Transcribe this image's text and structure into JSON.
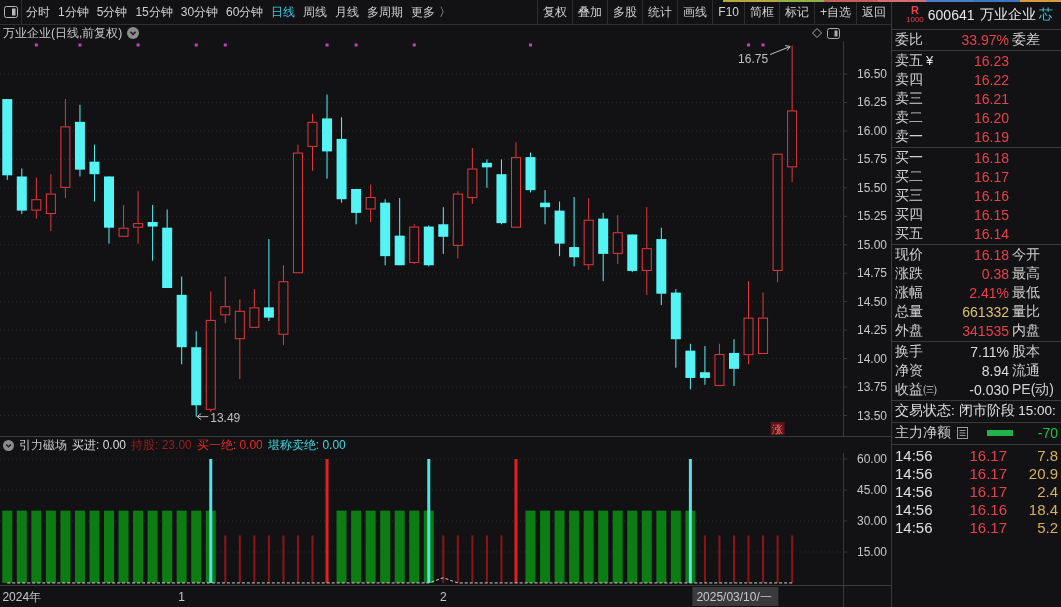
{
  "toolbar": {
    "periods": [
      {
        "label": "分时",
        "selected": false
      },
      {
        "label": "1分钟",
        "selected": false
      },
      {
        "label": "5分钟",
        "selected": false
      },
      {
        "label": "15分钟",
        "selected": false
      },
      {
        "label": "30分钟",
        "selected": false
      },
      {
        "label": "60分钟",
        "selected": false
      },
      {
        "label": "日线",
        "selected": true
      },
      {
        "label": "周线",
        "selected": false
      },
      {
        "label": "月线",
        "selected": false
      },
      {
        "label": "多周期",
        "selected": false
      },
      {
        "label": "更多 〉",
        "selected": false
      }
    ],
    "buttons": [
      "复权",
      "叠加",
      "多股",
      "统计",
      "画线",
      "F10",
      "简框",
      "标记",
      "+自选",
      "返回"
    ]
  },
  "chart": {
    "title": "万业企业(日线,前复权)",
    "signal_tag": "涨",
    "chart_data": [
      {
        "type": "candlestick",
        "ohlc": [
          [
            16.28,
            16.28,
            15.57,
            15.61
          ],
          [
            15.6,
            15.67,
            15.27,
            15.3
          ],
          [
            15.3,
            15.59,
            15.23,
            15.4
          ],
          [
            15.27,
            15.62,
            15.12,
            15.45
          ],
          [
            15.5,
            16.28,
            15.41,
            16.04
          ],
          [
            16.08,
            16.23,
            15.6,
            15.66
          ],
          [
            15.73,
            15.88,
            15.38,
            15.62
          ],
          [
            15.6,
            15.6,
            15.01,
            15.15
          ],
          [
            15.07,
            15.35,
            15.07,
            15.15
          ],
          [
            15.15,
            15.47,
            15.01,
            15.19
          ],
          [
            15.2,
            15.35,
            14.86,
            15.16
          ],
          [
            15.15,
            15.31,
            14.62,
            14.62
          ],
          [
            14.56,
            14.72,
            13.95,
            14.1
          ],
          [
            14.1,
            14.24,
            13.49,
            13.59
          ],
          [
            13.55,
            14.59,
            13.53,
            14.34
          ],
          [
            14.38,
            14.72,
            14.31,
            14.46
          ],
          [
            14.17,
            14.52,
            13.82,
            14.42
          ],
          [
            14.27,
            14.61,
            14.27,
            14.45
          ],
          [
            14.45,
            15.05,
            14.33,
            14.36
          ],
          [
            14.21,
            14.82,
            14.12,
            14.68
          ],
          [
            14.75,
            15.88,
            14.75,
            15.81
          ],
          [
            15.86,
            16.15,
            15.65,
            16.08
          ],
          [
            16.11,
            16.32,
            15.58,
            15.82
          ],
          [
            15.93,
            16.12,
            15.37,
            15.4
          ],
          [
            15.49,
            15.49,
            15.18,
            15.28
          ],
          [
            15.31,
            15.53,
            15.2,
            15.42
          ],
          [
            15.37,
            15.4,
            14.82,
            14.9
          ],
          [
            15.08,
            15.41,
            14.82,
            14.82
          ],
          [
            14.84,
            15.18,
            14.83,
            15.16
          ],
          [
            15.16,
            15.17,
            14.81,
            14.82
          ],
          [
            15.18,
            15.33,
            14.92,
            15.07
          ],
          [
            14.99,
            15.47,
            14.88,
            15.45
          ],
          [
            15.41,
            15.85,
            15.36,
            15.67
          ],
          [
            15.72,
            15.75,
            15.5,
            15.68
          ],
          [
            15.62,
            15.75,
            15.18,
            15.19
          ],
          [
            15.15,
            15.9,
            15.15,
            15.77
          ],
          [
            15.77,
            15.81,
            15.46,
            15.48
          ],
          [
            15.37,
            15.48,
            15.18,
            15.33
          ],
          [
            15.3,
            15.38,
            14.9,
            15.01
          ],
          [
            14.98,
            15.42,
            14.81,
            14.89
          ],
          [
            14.82,
            15.41,
            14.78,
            15.22
          ],
          [
            15.23,
            15.28,
            14.68,
            14.92
          ],
          [
            14.92,
            15.26,
            14.83,
            15.11
          ],
          [
            15.09,
            15.09,
            14.76,
            14.77
          ],
          [
            14.77,
            15.33,
            14.56,
            14.97
          ],
          [
            15.05,
            15.15,
            14.47,
            14.57
          ],
          [
            14.58,
            14.61,
            13.92,
            14.17
          ],
          [
            14.07,
            14.13,
            13.73,
            13.83
          ],
          [
            13.88,
            14.11,
            13.77,
            13.83
          ],
          [
            13.76,
            14.13,
            13.76,
            14.04
          ],
          [
            14.05,
            14.17,
            13.76,
            13.91
          ],
          [
            14.03,
            14.68,
            13.95,
            14.36
          ],
          [
            14.04,
            14.58,
            14.04,
            14.36
          ],
          [
            14.77,
            15.8,
            14.67,
            15.8
          ],
          [
            15.68,
            16.75,
            15.55,
            16.18
          ],
          null,
          null,
          null
        ],
        "ylim": [
          13.32,
          16.79
        ],
        "yticks": [
          {
            "value": 13.5,
            "label": "13.50"
          },
          {
            "value": 13.75,
            "label": "13.75"
          },
          {
            "value": 14,
            "label": "14.00"
          },
          {
            "value": 14.25,
            "label": "14.25"
          },
          {
            "value": 14.5,
            "label": "14.50"
          },
          {
            "value": 14.75,
            "label": "14.75"
          },
          {
            "value": 15,
            "label": "15.00"
          },
          {
            "value": 15.25,
            "label": "15.25"
          },
          {
            "value": 15.5,
            "label": "15.50"
          },
          {
            "value": 15.75,
            "label": "15.75"
          },
          {
            "value": 16,
            "label": "16.00"
          },
          {
            "value": 16.25,
            "label": "16.25"
          },
          {
            "value": 16.5,
            "label": "16.50"
          }
        ],
        "grid": true,
        "annotations": [
          "16.75",
          "13.49"
        ]
      }
    ]
  },
  "indicator": {
    "name": "引力磁场",
    "readouts": [
      {
        "text": "买进: 0.00",
        "color": "#dcdcdc"
      },
      {
        "text": "持股: 23.00",
        "color": "#9a1e1e"
      },
      {
        "text": "买一绝: 0.00",
        "color": "#e82828"
      },
      {
        "text": "堪称卖绝: 0.00",
        "color": "#40d8e0"
      }
    ],
    "cursor_date": "2025/03/10/一",
    "chart_data": [
      {
        "type": "bar",
        "categories": [
          null,
          "2024年",
          null,
          null,
          null,
          null,
          null,
          null,
          null,
          null,
          null,
          null,
          "1",
          null,
          null,
          null,
          null,
          null,
          null,
          null,
          null,
          null,
          null,
          null,
          null,
          null,
          null,
          null,
          null,
          null,
          "2",
          null,
          null,
          null,
          null,
          null,
          null,
          null,
          null,
          null,
          null,
          null,
          null,
          null,
          null,
          null,
          null,
          null,
          null,
          null,
          null,
          null,
          null,
          null,
          null,
          null,
          null,
          null
        ],
        "series": [
          {
            "type": "bar",
            "color": "#0b7d12",
            "values": [
              35,
              35,
              35,
              35,
              35,
              35,
              35,
              35,
              35,
              35,
              35,
              35,
              35,
              35,
              35,
              null,
              null,
              null,
              null,
              null,
              null,
              null,
              null,
              35,
              35,
              35,
              35,
              35,
              35,
              35,
              null,
              null,
              null,
              null,
              null,
              null,
              35,
              35,
              35,
              35,
              35,
              35,
              35,
              35,
              35,
              35,
              35,
              35,
              null,
              null,
              null,
              null,
              null,
              null,
              null,
              null,
              null,
              null
            ]
          },
          {
            "type": "bar",
            "color": "#8e1414",
            "values": [
              null,
              null,
              null,
              null,
              null,
              null,
              null,
              null,
              null,
              null,
              null,
              null,
              null,
              null,
              null,
              23,
              23,
              23,
              23,
              23,
              23,
              23,
              null,
              null,
              null,
              null,
              null,
              null,
              null,
              null,
              23,
              23,
              23,
              23,
              23,
              null,
              null,
              null,
              null,
              null,
              null,
              null,
              null,
              null,
              null,
              null,
              null,
              null,
              23,
              23,
              23,
              23,
              23,
              23,
              23,
              null,
              null,
              null
            ]
          },
          {
            "type": "bar",
            "color": "#e3201e",
            "values": [
              null,
              null,
              null,
              null,
              null,
              null,
              null,
              null,
              null,
              null,
              null,
              null,
              null,
              null,
              null,
              null,
              null,
              null,
              null,
              null,
              null,
              null,
              60,
              null,
              null,
              null,
              null,
              null,
              null,
              null,
              null,
              null,
              null,
              null,
              null,
              60,
              null,
              null,
              null,
              null,
              null,
              null,
              null,
              null,
              null,
              null,
              null,
              null,
              null,
              null,
              null,
              null,
              null,
              null,
              null,
              null,
              null,
              null
            ]
          },
          {
            "type": "bar",
            "color": "#4fe3ea",
            "values": [
              null,
              null,
              null,
              null,
              null,
              null,
              null,
              null,
              null,
              null,
              null,
              null,
              null,
              null,
              60,
              null,
              null,
              null,
              null,
              null,
              null,
              null,
              null,
              null,
              null,
              null,
              null,
              null,
              null,
              60,
              null,
              null,
              null,
              null,
              null,
              null,
              null,
              null,
              null,
              null,
              null,
              null,
              null,
              null,
              null,
              null,
              null,
              60,
              null,
              null,
              null,
              null,
              null,
              null,
              null,
              null,
              null,
              null
            ]
          },
          {
            "type": "line",
            "color": "#cfcfcf",
            "line_style": "dashed",
            "values": [
              0,
              0,
              0,
              0,
              0,
              0,
              0,
              0,
              0,
              0,
              0,
              0,
              0,
              0,
              0,
              0,
              0,
              0,
              0,
              0,
              0,
              0,
              0,
              0,
              0,
              0,
              0,
              0,
              0,
              0,
              2.5,
              0,
              0,
              0,
              0,
              0,
              0,
              0,
              0,
              0,
              0,
              0,
              0,
              0,
              0,
              0,
              0,
              0,
              0,
              0,
              0,
              0,
              0,
              0,
              0,
              null,
              null,
              null
            ]
          }
        ],
        "ylim": [
          -1,
          62.9
        ],
        "yticks": [
          {
            "value": 15,
            "label": "15.00"
          },
          {
            "value": 30,
            "label": "30.00"
          },
          {
            "value": 45,
            "label": "45.00"
          },
          {
            "value": 60,
            "label": "60.00"
          }
        ],
        "grid": true
      }
    ]
  },
  "quote_panel": {
    "badge": {
      "letter": "R",
      "number": "1000"
    },
    "code": "600641",
    "name": "万业企业",
    "tag": "芯",
    "ratio": {
      "label": "委比",
      "value": "33.97%",
      "label2": "委差"
    },
    "asks": [
      {
        "label": "卖五",
        "mark": "¥",
        "price": "16.23"
      },
      {
        "label": "卖四",
        "price": "16.22"
      },
      {
        "label": "卖三",
        "price": "16.21"
      },
      {
        "label": "卖二",
        "price": "16.20"
      },
      {
        "label": "卖一",
        "price": "16.19"
      }
    ],
    "bids": [
      {
        "label": "买一",
        "price": "16.18"
      },
      {
        "label": "买二",
        "price": "16.17"
      },
      {
        "label": "买三",
        "price": "16.16"
      },
      {
        "label": "买四",
        "price": "16.15"
      },
      {
        "label": "买五",
        "price": "16.14"
      }
    ],
    "stats": [
      {
        "label": "现价",
        "value": "16.18",
        "label2": "今开",
        "color": "#e8414b"
      },
      {
        "label": "涨跌",
        "value": "0.38",
        "label2": "最高",
        "color": "#e8414b"
      },
      {
        "label": "涨幅",
        "value": "2.41%",
        "label2": "最低",
        "color": "#e8414b"
      },
      {
        "label": "总量",
        "value": "661332",
        "label2": "量比",
        "color": "#e0c070"
      },
      {
        "label": "外盘",
        "value": "341535",
        "label2": "内盘",
        "color": "#e8414b"
      }
    ],
    "stats2": [
      {
        "label": "换手",
        "value": "7.11%",
        "label2": "股本",
        "color": "#dcdcdc"
      },
      {
        "label": "净资",
        "value": "8.94",
        "label2": "流通",
        "color": "#dcdcdc"
      },
      {
        "label": "收益㈢",
        "value": "-0.030",
        "label2": "PE(动)",
        "color": "#dcdcdc"
      }
    ],
    "status": "交易状态: 闭市阶段 15:00:",
    "net_flow": {
      "label": "主力净额",
      "value": "-70"
    },
    "trades": [
      {
        "time": "14:56",
        "price": "16.17",
        "volume": "7.8"
      },
      {
        "time": "14:56",
        "price": "16.17",
        "volume": "20.9"
      },
      {
        "time": "14:56",
        "price": "16.17",
        "volume": "2.4"
      },
      {
        "time": "14:56",
        "price": "16.16",
        "volume": "18.4"
      },
      {
        "time": "14:56",
        "price": "16.17",
        "volume": "5.2"
      }
    ]
  }
}
